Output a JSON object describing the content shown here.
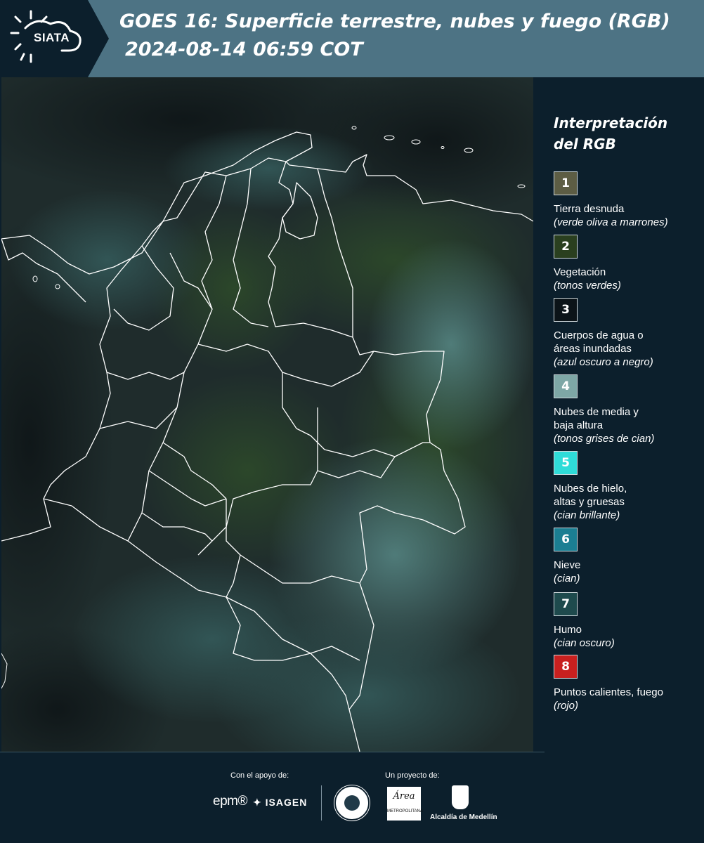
{
  "header": {
    "logo_text": "SIATA",
    "title": "GOES 16: Superficie terrestre, nubes y fuego (RGB)",
    "subtitle": "2024-08-14 06:59 COT"
  },
  "legend": {
    "title_line1": "Interpretación",
    "title_line2": "del RGB",
    "items": [
      {
        "number": "1",
        "label": "Tierra desnuda",
        "label2": "",
        "desc": "(verde oliva a marrones)",
        "color": "#5d5d44"
      },
      {
        "number": "2",
        "label": "Vegetación",
        "label2": "",
        "desc": "(tonos verdes)",
        "color": "#2a3f1f"
      },
      {
        "number": "3",
        "label": "Cuerpos de agua o",
        "label2": "áreas inundadas",
        "desc": "(azul oscuro a negro)",
        "color": "#0b1318"
      },
      {
        "number": "4",
        "label": "Nubes de media y",
        "label2": "baja altura",
        "desc": "(tonos grises de cian)",
        "color": "#7ea7a6"
      },
      {
        "number": "5",
        "label": "Nubes de hielo,",
        "label2": "altas y gruesas",
        "desc": "(cian brillante)",
        "color": "#2fdcd8"
      },
      {
        "number": "6",
        "label": "Nieve",
        "label2": "",
        "desc": "(cian)",
        "color": "#1b7e92"
      },
      {
        "number": "7",
        "label": "Humo",
        "label2": "",
        "desc": "(cian oscuro)",
        "color": "#1e4a4d"
      },
      {
        "number": "8",
        "label": "Puntos calientes, fuego",
        "label2": "",
        "desc": "(rojo)",
        "color": "#c8201f"
      }
    ]
  },
  "footer": {
    "support_label": "Con el apoyo de:",
    "project_label": "Un proyecto de:",
    "epm": "epm®",
    "isagen": "ISAGEN",
    "area_logo": "Área",
    "area_sub": "METROPOLITANA",
    "medellin": "Alcaldía de Medellín"
  },
  "colors": {
    "header_bg": "#4d7384",
    "page_bg": "#0c1f2c"
  }
}
